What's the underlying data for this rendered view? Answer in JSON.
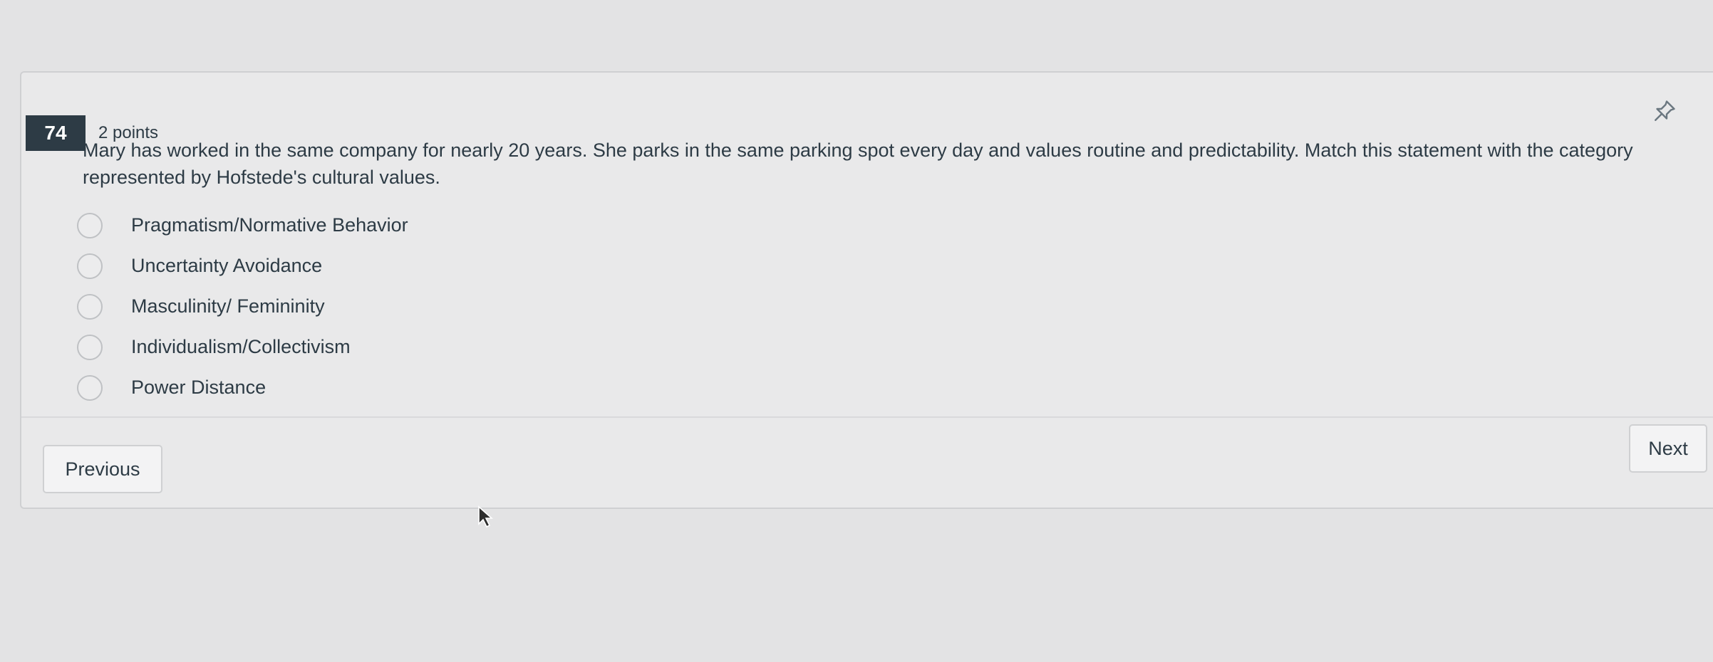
{
  "question": {
    "number": "74",
    "points": "2 points",
    "text": "Mary has worked in the same company for nearly 20 years. She parks in the same parking spot every day and values routine and predictability. Match this statement with the category represented by Hofstede's cultural values.",
    "options": [
      {
        "label": "Pragmatism/Normative Behavior",
        "selected": false
      },
      {
        "label": "Uncertainty Avoidance",
        "selected": false
      },
      {
        "label": "Masculinity/ Femininity",
        "selected": false
      },
      {
        "label": "Individualism/Collectivism",
        "selected": false
      },
      {
        "label": "Power Distance",
        "selected": false
      }
    ]
  },
  "nav": {
    "previous_label": "Previous",
    "next_label": "Next"
  },
  "icons": {
    "pin": "pin-icon",
    "cursor": "mouse-cursor-icon"
  },
  "colors": {
    "badge_bg": "#2d3b45",
    "text": "#2d3b45"
  }
}
